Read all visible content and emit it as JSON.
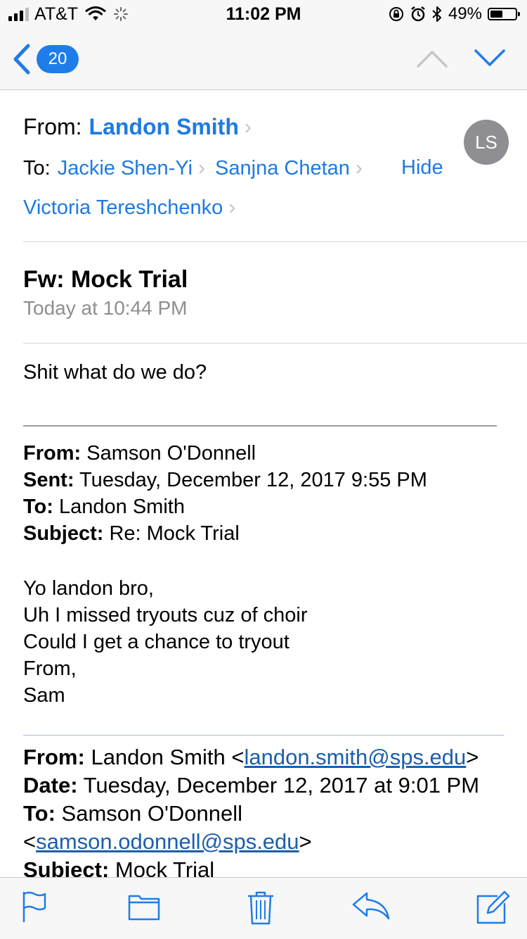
{
  "status_bar": {
    "carrier": "AT&T",
    "time": "11:02 PM",
    "battery": "49%",
    "battery_level": 0.49
  },
  "nav": {
    "badge_count": "20"
  },
  "header": {
    "from_label": "From:",
    "from_name": "Landon Smith",
    "avatar_initials": "LS",
    "to_label": "To:",
    "recipients": [
      "Jackie Shen-Yi",
      "Sanjna Chetan",
      "Victoria Tereshchenko"
    ],
    "hide_label": "Hide",
    "subject": "Fw: Mock Trial",
    "date": "Today at 10:44 PM"
  },
  "body": {
    "message": "Shit what do we do?",
    "forwarded_1": {
      "from_label": "From:",
      "from": "Samson O'Donnell",
      "sent_label": "Sent:",
      "sent": "Tuesday, December 12, 2017 9:55 PM",
      "to_label": "To:",
      "to": "Landon Smith",
      "subject_label": "Subject:",
      "subject": "Re: Mock Trial",
      "lines": [
        "Yo landon bro,",
        "Uh I missed tryouts cuz of choir",
        "Could I get a chance to tryout",
        "From,",
        "Sam"
      ]
    },
    "forwarded_2": {
      "from_label": "From:",
      "from_name": "Landon Smith <",
      "from_email": "landon.smith@sps.edu",
      "from_close": ">",
      "date_label": "Date:",
      "date": "Tuesday, December 12, 2017 at 9:01 PM",
      "to_label": "To:",
      "to_name": "Samson O'Donnell",
      "to_open": "<",
      "to_email": "samson.odonnell@sps.edu",
      "to_close": ">",
      "subject_label": "Subject:",
      "subject": "Mock Trial"
    }
  },
  "icons": {
    "toolbar": [
      "flag-icon",
      "folder-icon",
      "trash-icon",
      "reply-icon",
      "compose-icon"
    ]
  }
}
